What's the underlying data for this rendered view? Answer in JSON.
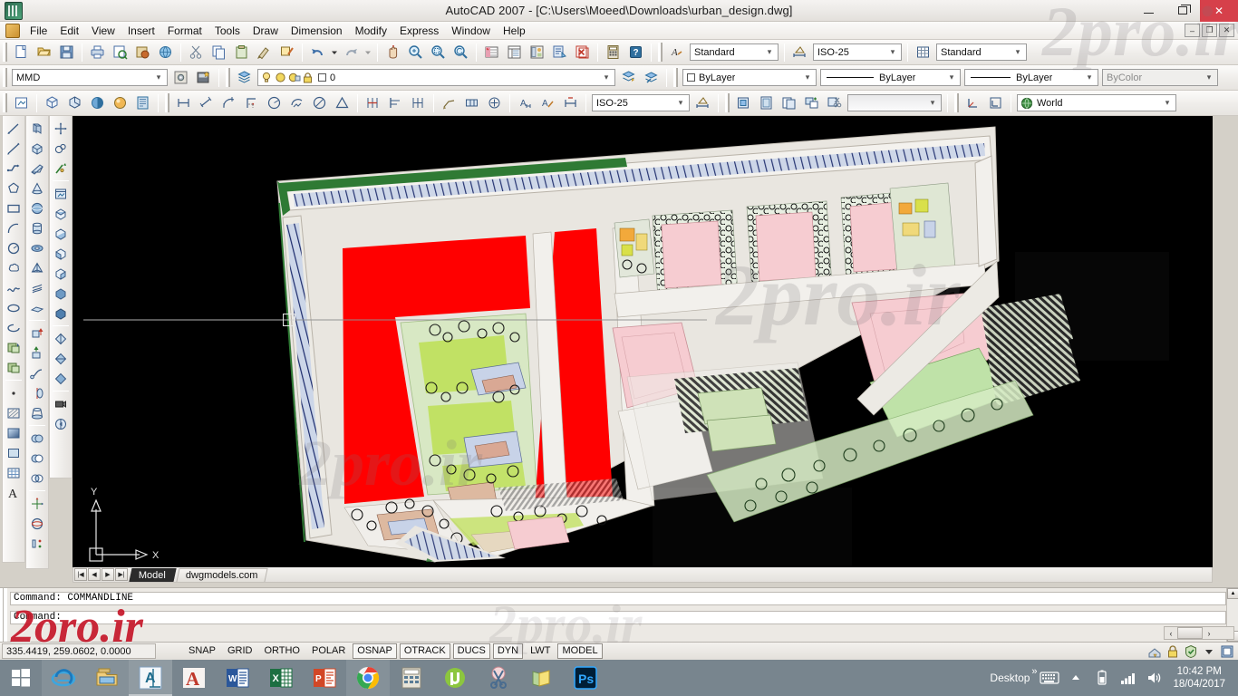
{
  "window": {
    "title": "AutoCAD 2007 - [C:\\Users\\Moeed\\Downloads\\urban_design.dwg]",
    "app_icon": "autocad-icon",
    "minimize": "–",
    "maximize": "❐",
    "close": "✕",
    "mdi_minimize": "–",
    "mdi_restore": "❐",
    "mdi_close": "✕"
  },
  "menu": {
    "items": [
      {
        "label": "File"
      },
      {
        "label": "Edit"
      },
      {
        "label": "View"
      },
      {
        "label": "Insert"
      },
      {
        "label": "Format"
      },
      {
        "label": "Tools"
      },
      {
        "label": "Draw"
      },
      {
        "label": "Dimension"
      },
      {
        "label": "Modify"
      },
      {
        "label": "Express"
      },
      {
        "label": "Window"
      },
      {
        "label": "Help"
      }
    ]
  },
  "standard_toolbar": {
    "buttons": [
      "new-icon",
      "open-icon",
      "save-icon",
      "plot-icon",
      "plot-preview-icon",
      "publish-icon",
      "3dprint-icon",
      "cut-icon",
      "copy-icon",
      "paste-icon",
      "match-properties-icon",
      "block-editor-icon",
      "undo-icon",
      "undo-dropdown-icon",
      "redo-icon",
      "redo-dropdown-icon",
      "pan-realtime-icon",
      "zoom-realtime-icon",
      "zoom-window-icon",
      "zoom-previous-icon",
      "properties-icon",
      "designcenter-icon",
      "tool-palettes-icon",
      "sheet-set-icon",
      "markup-icon",
      "quickcalc-icon",
      "help-icon"
    ],
    "styles": [
      {
        "name": "text-style",
        "icon": "text-style-icon",
        "value": "Standard"
      },
      {
        "name": "dimension-style",
        "icon": "dim-style-icon",
        "value": "ISO-25"
      },
      {
        "name": "table-style",
        "icon": "table-style-icon",
        "value": "Standard"
      }
    ]
  },
  "layers_toolbar": {
    "workspace_value": "MMD",
    "workspace_buttons": [
      "workspace-settings-icon",
      "my-workspace-icon"
    ],
    "layer_manager_icon": "layer-properties-icon",
    "layer_state_icons": [
      "layer-on-icon",
      "layer-freeze-icon",
      "layer-freeze-vp-icon",
      "layer-lock-icon",
      "layer-color-icon"
    ],
    "layer_value": "0",
    "layer_extra_icons": [
      "layer-previous-icon",
      "make-object-layer-icon"
    ],
    "properties": [
      {
        "name": "color-control",
        "value": "ByLayer",
        "type": "color"
      },
      {
        "name": "linetype-control",
        "value": "ByLayer",
        "type": "line"
      },
      {
        "name": "lineweight-control",
        "value": "ByLayer",
        "type": "line"
      },
      {
        "name": "plotstyle-control",
        "value": "ByColor",
        "type": "plain",
        "disabled": true
      }
    ]
  },
  "styles_toolbar": {
    "view_buttons": [
      "named-views-icon",
      "sw-iso-icon",
      "se-iso-icon",
      "shade-icon",
      "render-icon",
      "visual-styles-icon"
    ],
    "dimension_buttons": [
      "linear-dim-icon",
      "aligned-dim-icon",
      "arc-length-dim-icon",
      "ordinate-dim-icon",
      "radius-dim-icon",
      "jogged-dim-icon",
      "diameter-dim-icon",
      "angular-dim-icon",
      "quick-dim-icon",
      "baseline-dim-icon",
      "continue-dim-icon",
      "quick-leader-icon",
      "tolerance-icon",
      "center-mark-icon",
      "dim-edit-icon",
      "dim-text-edit-icon",
      "dim-update-icon"
    ],
    "dim_style_value": "ISO-25",
    "dim_style_manager_icon": "dim-style-manager-icon",
    "layout_buttons": [
      "insert-block-icon",
      "layout-icon",
      "layout-from-template-icon",
      "new-viewport-icon",
      "clip-viewport-icon"
    ],
    "viewport_scale_value": "",
    "ucs_buttons": [
      "ucs-icon-btn",
      "ucs-manager-icon"
    ],
    "ucs_value": "World",
    "ucs_globe_icon": "world-globe-icon"
  },
  "draw_toolbar": {
    "name": "draw-toolbar",
    "buttons": [
      "line-icon",
      "construction-line-icon",
      "polyline-icon",
      "polygon-icon",
      "rectangle-icon",
      "arc-icon",
      "circle-icon",
      "revision-cloud-icon",
      "spline-icon",
      "ellipse-icon",
      "ellipse-arc-icon",
      "insert-block-icon",
      "make-block-icon",
      "point-icon",
      "hatch-icon",
      "gradient-icon",
      "region-icon",
      "table-icon",
      "multiline-text-icon"
    ]
  },
  "modeling_toolbar": {
    "name": "modeling-toolbar",
    "buttons": [
      "polysolid-icon",
      "box-icon",
      "wedge-icon",
      "cone-icon",
      "sphere-icon",
      "cylinder-icon",
      "torus-icon",
      "pyramid-icon",
      "helix-icon",
      "planar-surface-icon",
      "extrude-icon",
      "presspull-icon",
      "sweep-icon",
      "revolve-icon",
      "loft-icon",
      "union-icon",
      "subtract-icon",
      "intersect-icon",
      "3d-move-icon",
      "3d-rotate-icon",
      "3d-align-icon"
    ]
  },
  "view_toolbar": {
    "name": "view-toolbar",
    "buttons": [
      "3d-move-gizmo-icon",
      "3d-orbit-icon",
      "3d-walk-icon",
      "named-views-icon",
      "top-view-icon",
      "bottom-view-icon",
      "left-view-icon",
      "right-view-icon",
      "front-view-icon",
      "back-view-icon",
      "sw-isometric-icon",
      "se-isometric-icon",
      "ne-isometric-icon",
      "camera-icon",
      "back-clip-icon"
    ]
  },
  "modify_toolbar": {
    "name": "modify-toolbar",
    "buttons": [
      "erase-icon",
      "copy-icon",
      "mirror-icon",
      "offset-icon",
      "array-icon",
      "move-icon",
      "rotate-icon",
      "scale-icon",
      "stretch-icon",
      "trim-icon",
      "extend-icon",
      "break-at-point-icon",
      "break-icon",
      "join-icon",
      "chamfer-icon",
      "fillet-icon",
      "explode-icon"
    ]
  },
  "drawing": {
    "title": "urban-design-site-plan",
    "crosshair": {
      "visible": true
    },
    "ucs_icon": {
      "x_label": "X",
      "y_label": "Y"
    }
  },
  "layout_tabs": {
    "nav": [
      "first-tab-icon",
      "prev-tab-icon",
      "next-tab-icon",
      "last-tab-icon"
    ],
    "tabs": [
      {
        "label": "Model",
        "active": true
      },
      {
        "label": "dwgmodels.com",
        "active": false
      }
    ]
  },
  "command_window": {
    "lines": [
      "Command: COMMANDLINE",
      "Command:"
    ],
    "scroll_up": "▲",
    "scroll_down": "▼",
    "hscroll_left": "‹",
    "hscroll_right": "›"
  },
  "status_bar": {
    "coordinates": "335.4419, 259.0602, 0.0000",
    "toggles": [
      {
        "label": "SNAP",
        "on": false
      },
      {
        "label": "GRID",
        "on": false
      },
      {
        "label": "ORTHO",
        "on": false
      },
      {
        "label": "POLAR",
        "on": false
      },
      {
        "label": "OSNAP",
        "on": true
      },
      {
        "label": "OTRACK",
        "on": true
      },
      {
        "label": "DUCS",
        "on": true
      },
      {
        "label": "DYN",
        "on": true
      },
      {
        "label": "LWT",
        "on": false
      },
      {
        "label": "MODEL",
        "on": true
      }
    ],
    "tray_icons": [
      "comm-center-icon",
      "manage-xrefs-icon",
      "trusted-autodesk-icon",
      "tray-menu-icon",
      "clean-screen-icon"
    ]
  },
  "taskbar": {
    "start": "start-windows-icon",
    "apps": [
      {
        "name": "internet-explorer",
        "icon": "ie-icon",
        "state": "pinned"
      },
      {
        "name": "file-explorer",
        "icon": "explorer-icon",
        "state": "pinned"
      },
      {
        "name": "autocad",
        "icon": "autocad-icon",
        "state": "active"
      },
      {
        "name": "autodesk",
        "icon": "autodesk-a-icon",
        "state": "normal"
      },
      {
        "name": "word",
        "icon": "word-icon",
        "state": "normal"
      },
      {
        "name": "excel",
        "icon": "excel-icon",
        "state": "normal"
      },
      {
        "name": "powerpoint",
        "icon": "powerpoint-icon",
        "state": "normal"
      },
      {
        "name": "chrome",
        "icon": "chrome-icon",
        "state": "pinned"
      },
      {
        "name": "calculator",
        "icon": "calculator-icon",
        "state": "normal"
      },
      {
        "name": "utorrent",
        "icon": "utorrent-icon",
        "state": "normal"
      },
      {
        "name": "snipping-tool",
        "icon": "scissors-icon",
        "state": "normal"
      },
      {
        "name": "folders",
        "icon": "folders-icon",
        "state": "normal"
      },
      {
        "name": "photoshop",
        "icon": "photoshop-icon",
        "state": "normal"
      }
    ],
    "desktop_label": "Desktop",
    "overflow": "»",
    "tray": [
      "keyboard-icon",
      "show-hidden-icon",
      "battery-icon",
      "network-icon",
      "volume-icon"
    ],
    "clock_time": "10:42 PM",
    "clock_date": "18/04/2017"
  },
  "watermark": {
    "main": "2oro.ir",
    "faint": "2pro.ir"
  },
  "colors": {
    "accent_red": "#c6172a",
    "canvas_bg": "#000000",
    "plan_red": "#ff0000",
    "plan_green": "#a8e060",
    "plan_pink": "#f4c8cc",
    "taskbar": "#78858e",
    "close_button": "#d6404a"
  }
}
